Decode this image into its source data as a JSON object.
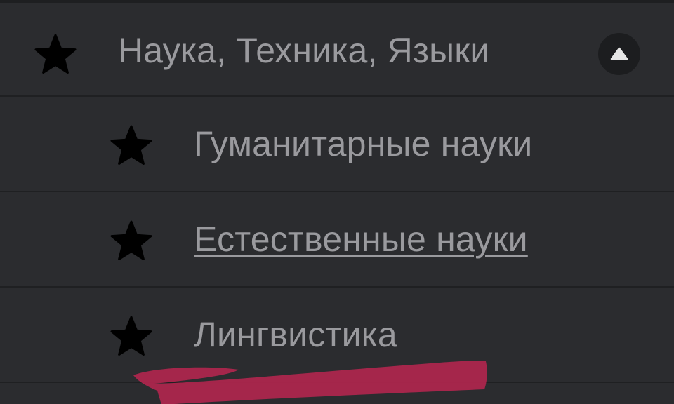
{
  "menu": {
    "category": {
      "label": "Наука, Техника, Языки",
      "icon": "star-icon",
      "toggle_icon": "chevron-up-icon",
      "expanded": true
    },
    "subcategories": [
      {
        "label": "Гуманитарные науки",
        "icon": "star-icon",
        "underlined": false
      },
      {
        "label": "Естественные науки",
        "icon": "star-icon",
        "underlined": true
      },
      {
        "label": "Лингвистика",
        "icon": "star-icon",
        "underlined": false
      }
    ]
  },
  "colors": {
    "background": "#2b2c2f",
    "divider": "#1f2022",
    "text": "#9a9a9e",
    "icon": "#000000",
    "toggle_button": "#1c1d1f",
    "toggle_arrow": "#e6e6e6",
    "scribble": "#b0264e"
  }
}
